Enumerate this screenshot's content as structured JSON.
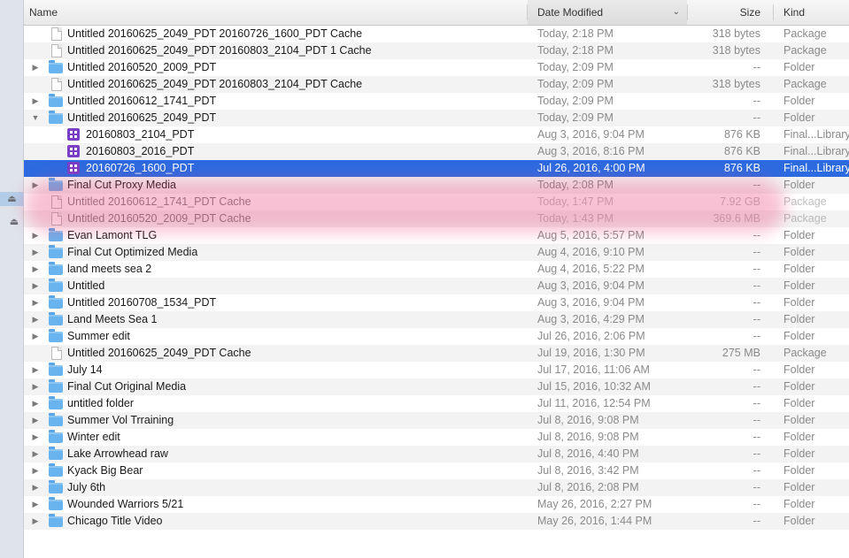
{
  "columns": {
    "name": "Name",
    "date": "Date Modified",
    "size": "Size",
    "kind": "Kind"
  },
  "colors": {
    "selection": "#2c6ae0",
    "folder": "#69b3ee",
    "library": "#7a3fc6",
    "redaction": "#ec407a"
  },
  "rows": [
    {
      "name": "Untitled 20160625_2049_PDT 20160726_1600_PDT Cache",
      "date": "Today, 2:18 PM",
      "size": "318 bytes",
      "kind": "Package",
      "icon": "document-icon",
      "indent": 0,
      "disclosure": "none"
    },
    {
      "name": "Untitled 20160625_2049_PDT 20160803_2104_PDT 1 Cache",
      "date": "Today, 2:18 PM",
      "size": "318 bytes",
      "kind": "Package",
      "icon": "document-icon",
      "indent": 0,
      "disclosure": "none"
    },
    {
      "name": "Untitled 20160520_2009_PDT",
      "date": "Today, 2:09 PM",
      "size": "--",
      "kind": "Folder",
      "icon": "folder-icon",
      "indent": 0,
      "disclosure": "closed"
    },
    {
      "name": "Untitled 20160625_2049_PDT 20160803_2104_PDT Cache",
      "date": "Today, 2:09 PM",
      "size": "318 bytes",
      "kind": "Package",
      "icon": "document-icon",
      "indent": 0,
      "disclosure": "none"
    },
    {
      "name": "Untitled 20160612_1741_PDT",
      "date": "Today, 2:09 PM",
      "size": "--",
      "kind": "Folder",
      "icon": "folder-icon",
      "indent": 0,
      "disclosure": "closed"
    },
    {
      "name": "Untitled 20160625_2049_PDT",
      "date": "Today, 2:09 PM",
      "size": "--",
      "kind": "Folder",
      "icon": "folder-icon",
      "indent": 0,
      "disclosure": "open"
    },
    {
      "name": "20160803_2104_PDT",
      "date": "Aug 3, 2016, 9:04 PM",
      "size": "876 KB",
      "kind": "Final...Library",
      "icon": "fcp-library-icon",
      "indent": 1,
      "disclosure": "none"
    },
    {
      "name": "20160803_2016_PDT",
      "date": "Aug 3, 2016, 8:16 PM",
      "size": "876 KB",
      "kind": "Final...Library",
      "icon": "fcp-library-icon",
      "indent": 1,
      "disclosure": "none"
    },
    {
      "name": "20160726_1600_PDT",
      "date": "Jul 26, 2016, 4:00 PM",
      "size": "876 KB",
      "kind": "Final...Library",
      "icon": "fcp-library-icon",
      "indent": 1,
      "disclosure": "none",
      "selected": true
    },
    {
      "name": "Final Cut Proxy Media",
      "date": "Today, 2:08 PM",
      "size": "--",
      "kind": "Folder",
      "icon": "folder-icon",
      "indent": 0,
      "disclosure": "closed"
    },
    {
      "name": "Untitled 20160612_1741_PDT Cache",
      "date": "Today, 1:47 PM",
      "size": "7.92 GB",
      "kind": "Package",
      "icon": "document-icon",
      "indent": 0,
      "disclosure": "none",
      "redacted": true
    },
    {
      "name": "Untitled 20160520_2009_PDT Cache",
      "date": "Today, 1:43 PM",
      "size": "369.6 MB",
      "kind": "Package",
      "icon": "document-icon",
      "indent": 0,
      "disclosure": "none",
      "redacted": true
    },
    {
      "name": "Evan Lamont TLG",
      "date": "Aug 5, 2016, 5:57 PM",
      "size": "--",
      "kind": "Folder",
      "icon": "folder-icon",
      "indent": 0,
      "disclosure": "closed"
    },
    {
      "name": "Final Cut Optimized Media",
      "date": "Aug 4, 2016, 9:10 PM",
      "size": "--",
      "kind": "Folder",
      "icon": "folder-icon",
      "indent": 0,
      "disclosure": "closed"
    },
    {
      "name": "land meets sea 2",
      "date": "Aug 4, 2016, 5:22 PM",
      "size": "--",
      "kind": "Folder",
      "icon": "folder-icon",
      "indent": 0,
      "disclosure": "closed"
    },
    {
      "name": "Untitled",
      "date": "Aug 3, 2016, 9:04 PM",
      "size": "--",
      "kind": "Folder",
      "icon": "folder-icon",
      "indent": 0,
      "disclosure": "closed"
    },
    {
      "name": "Untitled 20160708_1534_PDT",
      "date": "Aug 3, 2016, 9:04 PM",
      "size": "--",
      "kind": "Folder",
      "icon": "folder-icon",
      "indent": 0,
      "disclosure": "closed"
    },
    {
      "name": "Land Meets Sea 1",
      "date": "Aug 3, 2016, 4:29 PM",
      "size": "--",
      "kind": "Folder",
      "icon": "folder-icon",
      "indent": 0,
      "disclosure": "closed"
    },
    {
      "name": "Summer edit",
      "date": "Jul 26, 2016, 2:06 PM",
      "size": "--",
      "kind": "Folder",
      "icon": "folder-icon",
      "indent": 0,
      "disclosure": "closed"
    },
    {
      "name": "Untitled 20160625_2049_PDT Cache",
      "date": "Jul 19, 2016, 1:30 PM",
      "size": "275 MB",
      "kind": "Package",
      "icon": "document-icon",
      "indent": 0,
      "disclosure": "none"
    },
    {
      "name": "July 14",
      "date": "Jul 17, 2016, 11:06 AM",
      "size": "--",
      "kind": "Folder",
      "icon": "folder-icon",
      "indent": 0,
      "disclosure": "closed"
    },
    {
      "name": "Final Cut Original Media",
      "date": "Jul 15, 2016, 10:32 AM",
      "size": "--",
      "kind": "Folder",
      "icon": "folder-icon",
      "indent": 0,
      "disclosure": "closed"
    },
    {
      "name": "untitled folder",
      "date": "Jul 11, 2016, 12:54 PM",
      "size": "--",
      "kind": "Folder",
      "icon": "folder-icon",
      "indent": 0,
      "disclosure": "closed"
    },
    {
      "name": "Summer Vol Trraining",
      "date": "Jul 8, 2016, 9:08 PM",
      "size": "--",
      "kind": "Folder",
      "icon": "folder-icon",
      "indent": 0,
      "disclosure": "closed"
    },
    {
      "name": "Winter edit",
      "date": "Jul 8, 2016, 9:08 PM",
      "size": "--",
      "kind": "Folder",
      "icon": "folder-icon",
      "indent": 0,
      "disclosure": "closed"
    },
    {
      "name": "Lake Arrowhead raw",
      "date": "Jul 8, 2016, 4:40 PM",
      "size": "--",
      "kind": "Folder",
      "icon": "folder-icon",
      "indent": 0,
      "disclosure": "closed"
    },
    {
      "name": "Kyack Big Bear",
      "date": "Jul 8, 2016, 3:42 PM",
      "size": "--",
      "kind": "Folder",
      "icon": "folder-icon",
      "indent": 0,
      "disclosure": "closed"
    },
    {
      "name": "July 6th",
      "date": "Jul 8, 2016, 2:08 PM",
      "size": "--",
      "kind": "Folder",
      "icon": "folder-icon",
      "indent": 0,
      "disclosure": "closed"
    },
    {
      "name": "Wounded Warriors 5/21",
      "date": "May 26, 2016, 2:27 PM",
      "size": "--",
      "kind": "Folder",
      "icon": "folder-icon",
      "indent": 0,
      "disclosure": "closed"
    },
    {
      "name": "Chicago Title Video",
      "date": "May 26, 2016, 1:44 PM",
      "size": "--",
      "kind": "Folder",
      "icon": "folder-icon",
      "indent": 0,
      "disclosure": "closed"
    }
  ]
}
